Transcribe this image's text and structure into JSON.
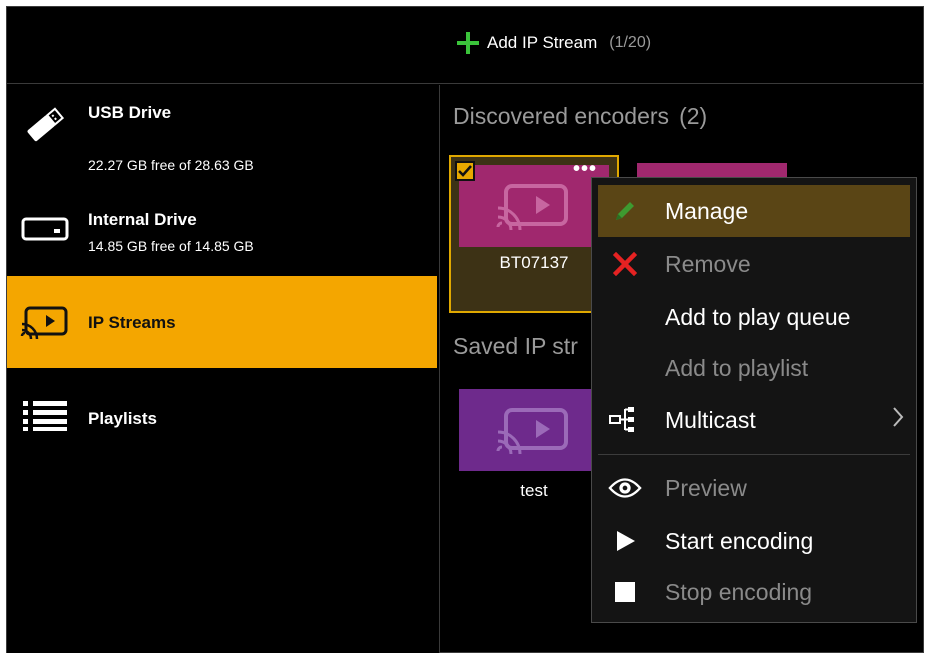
{
  "topbar": {
    "add_stream_label": "Add IP Stream",
    "add_stream_count": "(1/20)"
  },
  "sidebar": {
    "items": [
      {
        "title": "USB Drive",
        "subtitle": "22.27 GB free of 28.63 GB",
        "icon": "usb-drive-icon"
      },
      {
        "title": "Internal Drive",
        "subtitle": "14.85 GB free of 14.85 GB",
        "icon": "internal-drive-icon"
      },
      {
        "title": "IP Streams",
        "subtitle": "",
        "icon": "ip-stream-icon"
      },
      {
        "title": "Playlists",
        "subtitle": "",
        "icon": "playlist-icon"
      }
    ],
    "active_index": 2
  },
  "main": {
    "discovered": {
      "title": "Discovered encoders",
      "count": "(2)",
      "tiles": [
        {
          "name": "BT07137",
          "selected": true
        },
        {
          "name": "",
          "selected": false
        }
      ]
    },
    "saved": {
      "title": "Saved IP str",
      "tiles": [
        {
          "name": "test"
        }
      ]
    }
  },
  "context_menu": {
    "items": [
      {
        "label": "Manage",
        "icon": "pencil-icon",
        "enabled": true,
        "highlighted": true
      },
      {
        "label": "Remove",
        "icon": "close-x-icon",
        "enabled": false
      },
      {
        "label": "Add to play queue",
        "icon": "",
        "enabled": true
      },
      {
        "label": "Add to playlist",
        "icon": "",
        "enabled": false
      },
      {
        "label": "Multicast",
        "icon": "multicast-icon",
        "enabled": true,
        "submenu": true
      },
      {
        "label": "Preview",
        "icon": "eye-icon",
        "enabled": false
      },
      {
        "label": "Start encoding",
        "icon": "play-icon",
        "enabled": true
      },
      {
        "label": "Stop encoding",
        "icon": "stop-icon",
        "enabled": false
      }
    ]
  },
  "colors": {
    "accent": "#f4a600",
    "tile_pink": "#a0286e",
    "tile_purple": "#6e2a8c",
    "plus_green": "#3bc43b",
    "remove_red": "#e52222",
    "pencil_green": "#3e9a30"
  }
}
